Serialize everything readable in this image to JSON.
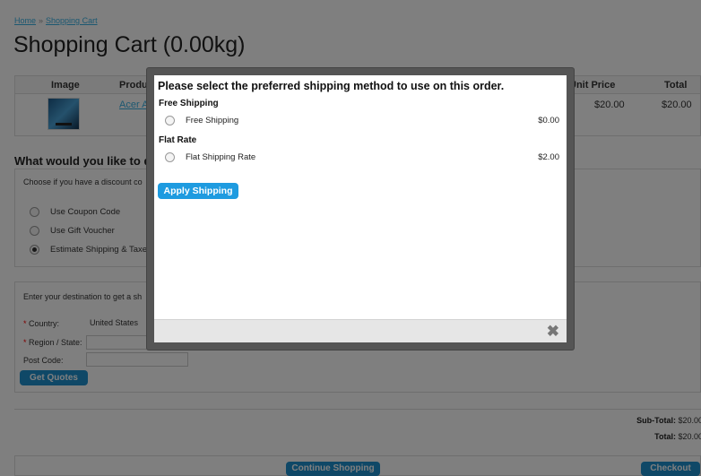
{
  "breadcrumb": {
    "home": "Home",
    "separator": "»",
    "current": "Shopping Cart"
  },
  "page_title": "Shopping Cart  (0.00kg)",
  "cart": {
    "headers": {
      "image": "Image",
      "product": "Produc",
      "unit_price": "Unit Price",
      "total": "Total"
    },
    "row": {
      "product": "Acer Ac",
      "unit_price": "$20.00",
      "total": "$20.00"
    }
  },
  "discount": {
    "title": "What would you like to d",
    "intro": "Choose if you have a discount co",
    "options": [
      "Use Coupon Code",
      "Use Gift Voucher",
      "Estimate Shipping & Taxes"
    ],
    "selected_index": 2
  },
  "estimate": {
    "intro": "Enter your destination to get a sh",
    "country_label": "Country:",
    "country_value": "United States",
    "region_label": "Region / State:",
    "postcode_label": "Post Code:",
    "get_quotes": "Get Quotes"
  },
  "totals": {
    "subtotal_label": "Sub-Total:",
    "subtotal_value": "$20.00",
    "total_label": "Total:",
    "total_value": "$20.00"
  },
  "footer": {
    "continue": "Continue Shopping",
    "checkout": "Checkout"
  },
  "modal": {
    "title": "Please select the preferred shipping method to use on this order.",
    "groups": [
      {
        "title": "Free Shipping",
        "method": "Free Shipping",
        "price": "$0.00"
      },
      {
        "title": "Flat Rate",
        "method": "Flat Shipping Rate",
        "price": "$2.00"
      }
    ],
    "apply": "Apply Shipping",
    "close": "✖"
  },
  "colors": {
    "accent": "#1e91cf",
    "link": "#38b0e3",
    "overlay": "rgba(0,0,0,0.5)"
  }
}
